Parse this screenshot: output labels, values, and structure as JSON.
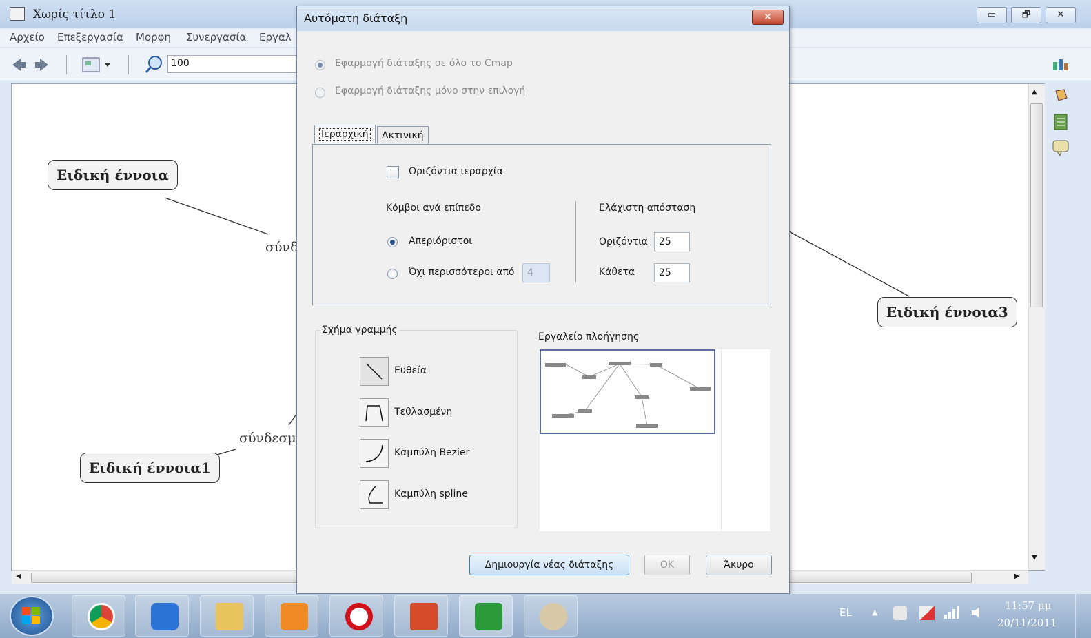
{
  "main_window": {
    "title": "Χωρίς τίτλο 1",
    "menu": [
      "Αρχείο",
      "Επεξεργασία",
      "Μορφη",
      "Συνεργασία",
      "Εργαλ"
    ],
    "zoom_value": "100",
    "buttons": {
      "minimize": "▭",
      "restore": "🗗",
      "close": "✕"
    }
  },
  "concept_map": {
    "concepts": [
      "Ειδική έννοια",
      "Ειδική έννοια1",
      "Ειδική έννοια3"
    ],
    "linking_phrases": [
      "σύνδ",
      "σύνδεσμ"
    ]
  },
  "dialog": {
    "title": "Αυτόματη διάταξη",
    "close_label": "✕",
    "scope_options": [
      "Εφαρμογή διάταξης σε όλο το Cmap",
      "Εφαρμογή διάταξης μόνο στην επιλογή"
    ],
    "tabs": [
      "Ιεραρχική",
      "Ακτινική"
    ],
    "horizontal_hierarchy_label": "Οριζόντια ιεραρχία",
    "nodes_per_level": {
      "heading": "Κόμβοι ανά επίπεδο",
      "unlimited_label": "Απεριόριστοι",
      "no_more_than_label": "Όχι περισσότεροι από",
      "no_more_than_value": "4"
    },
    "min_distance": {
      "heading": "Ελάχιστη απόσταση",
      "horizontal_label": "Οριζόντια",
      "horizontal_value": "25",
      "vertical_label": "Κάθετα",
      "vertical_value": "25"
    },
    "line_shape": {
      "heading": "Σχήμα γραμμής",
      "options": [
        "Ευθεία",
        "Τεθλασμένη",
        "Καμπύλη Bezier",
        "Καμπύλη spline"
      ]
    },
    "navigator_heading": "Εργαλείο πλοήγησης",
    "buttons": {
      "create": "Δημιουργία νέας διάταξης",
      "ok": "OK",
      "cancel": "Άκυρο"
    }
  },
  "taskbar": {
    "language": "EL",
    "time": "11:57 μμ",
    "date": "20/11/2011",
    "apps": [
      "chrome-icon",
      "teamviewer-icon",
      "explorer-icon",
      "media-player-icon",
      "opera-icon",
      "presentation-icon",
      "cmaptools-icon",
      "paint-icon"
    ]
  }
}
